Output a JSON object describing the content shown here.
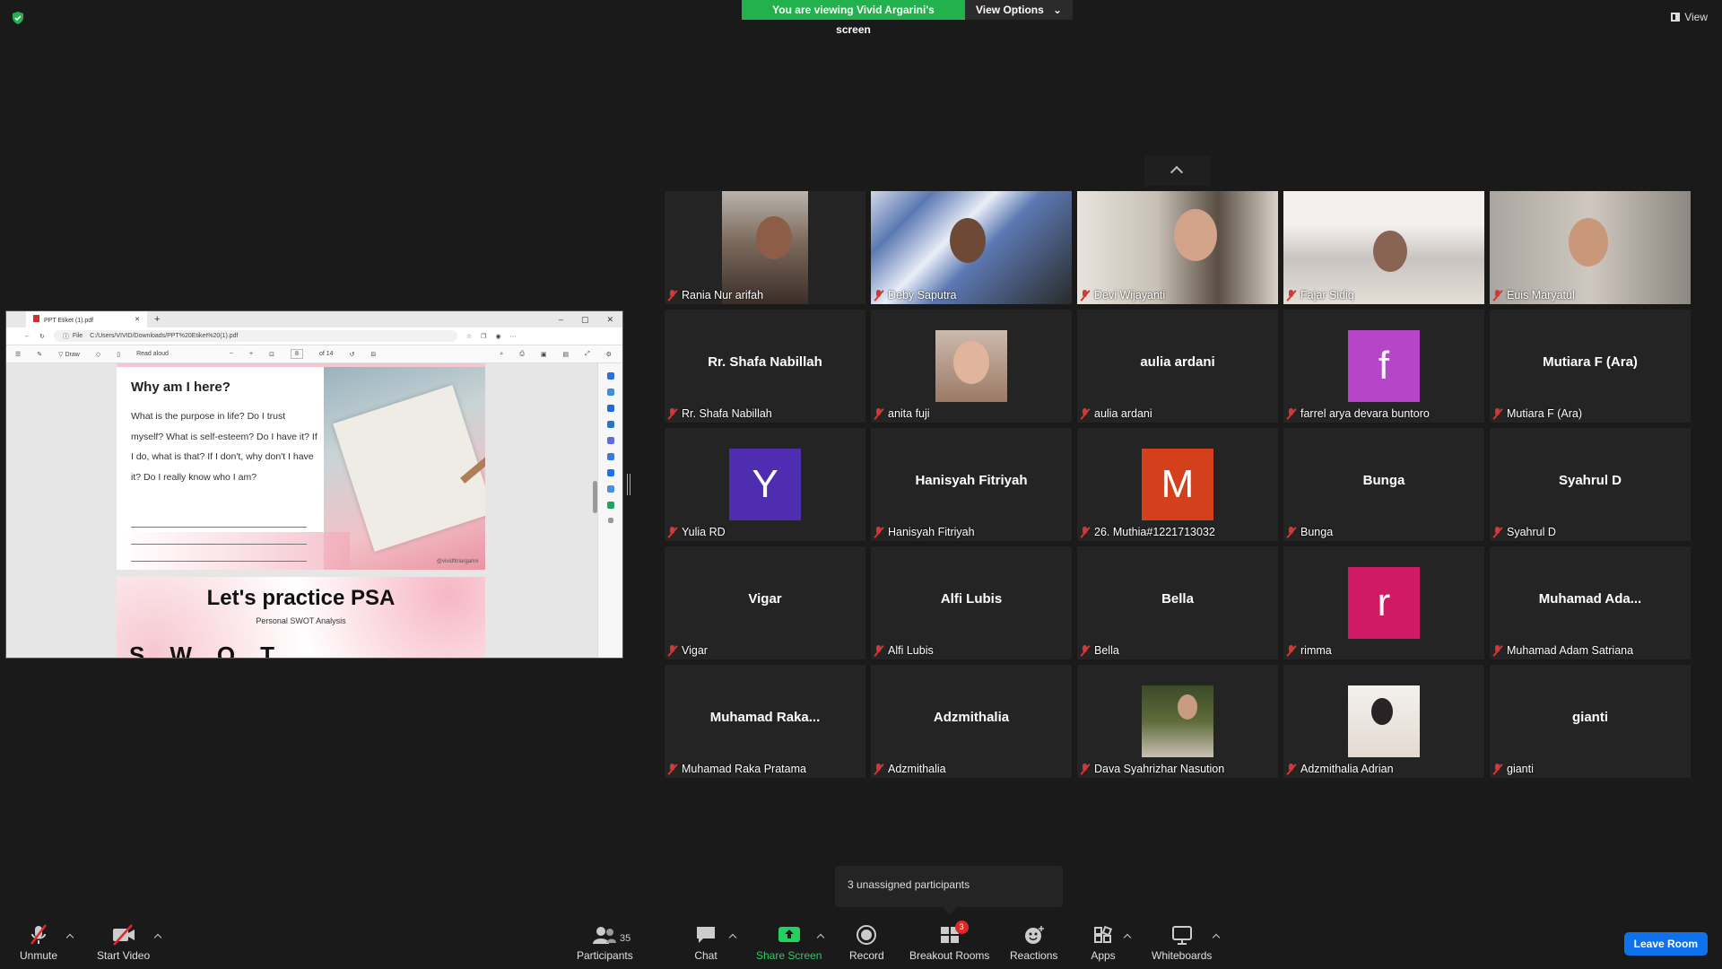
{
  "banner": {
    "viewing": "You are viewing Vivid Argarini's screen",
    "view_options": "View Options"
  },
  "view_button": "View",
  "browser": {
    "tab_title": "PPT Etiket (1).pdf",
    "url_prefix": "File",
    "url": "C:/Users/VIVID/Downloads/PPT%20Etiket%20(1).pdf",
    "draw": "Draw",
    "read_aloud": "Read aloud",
    "page_number": "8",
    "page_total": "of 14"
  },
  "pdf": {
    "handle": "@vividfitriargarini",
    "title": "Why am I here?",
    "questions": "What is the purpose in life? Do I trust myself? What is self-esteem? Do I have it? If I do, what is that? If I don't, why don't I have it? Do I really know who I am?",
    "title2": "Let's practice PSA",
    "subtitle2": "Personal SWOT Analysis",
    "swot": "SWOT"
  },
  "tiles": [
    {
      "name": "Rania Nur arifah"
    },
    {
      "name": "Deby Saputra"
    },
    {
      "name": "Devi Wijayanti"
    },
    {
      "name": "Fajar Sidiq"
    },
    {
      "name": "Euis Maryatul"
    },
    {
      "big": "Rr. Shafa Nabillah",
      "name": "Rr. Shafa Nabillah"
    },
    {
      "name": "anita fuji"
    },
    {
      "big": "aulia ardani",
      "name": "aulia ardani"
    },
    {
      "letter": "f",
      "color": "#b546c7",
      "name": "farrel arya devara buntoro"
    },
    {
      "big": "Mutiara F (Ara)",
      "name": "Mutiara F (Ara)"
    },
    {
      "letter": "Y",
      "color": "#4f2db0",
      "name": "Yulia RD"
    },
    {
      "big": "Hanisyah Fitriyah",
      "name": "Hanisyah Fitriyah"
    },
    {
      "letter": "M",
      "color": "#d4401b",
      "name": "26. Muthia#1221713032"
    },
    {
      "big": "Bunga",
      "name": "Bunga"
    },
    {
      "big": "Syahrul D",
      "name": "Syahrul D"
    },
    {
      "big": "Vigar",
      "name": "Vigar"
    },
    {
      "big": "Alfi Lubis",
      "name": "Alfi Lubis"
    },
    {
      "big": "Bella",
      "name": "Bella"
    },
    {
      "letter": "r",
      "color": "#d11a64",
      "name": "rimma"
    },
    {
      "big": "Muhamad  Ada...",
      "name": "Muhamad Adam Satriana"
    },
    {
      "big": "Muhamad  Raka...",
      "name": "Muhamad Raka Pratama"
    },
    {
      "big": "Adzmithalia",
      "name": "Adzmithalia"
    },
    {
      "name": "Dava Syahrizhar Nasution"
    },
    {
      "name": "Adzmithalia Adrian"
    },
    {
      "big": "gianti",
      "name": "gianti"
    }
  ],
  "tooltip": "3 unassigned participants",
  "toolbar": {
    "unmute": "Unmute",
    "start_video": "Start Video",
    "participants": "Participants",
    "participants_count": "35",
    "chat": "Chat",
    "share_screen": "Share Screen",
    "record": "Record",
    "breakout_rooms": "Breakout Rooms",
    "breakout_badge": "3",
    "reactions": "Reactions",
    "apps": "Apps",
    "whiteboards": "Whiteboards",
    "leave": "Leave Room"
  },
  "colors": {
    "green": "#23b14d",
    "leave_blue": "#0e72ed",
    "muted_red": "#d23838",
    "tile_bg": "#242424"
  }
}
